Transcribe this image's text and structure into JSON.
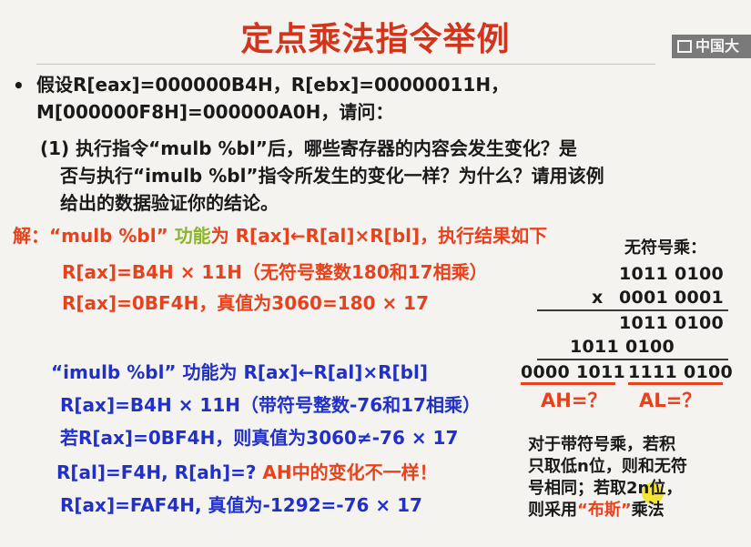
{
  "title": "定点乘法指令举例",
  "logo_text": "中国大",
  "problem": {
    "line1": "假设R[eax]=000000B4H，R[ebx]=00000011H，",
    "line2": "M[000000F8H]=000000A0H，请问：",
    "q1_line1": "(1) 执行指令“mulb %bl”后，哪些寄存器的内容会发生变化？是",
    "q1_line2": "否与执行“imulb %bl”指令所发生的变化一样？为什么？请用该例",
    "q1_line3": "给出的数据验证你的结论。"
  },
  "solution": {
    "prefix": "解：“mulb %bl”",
    "func_word": "功能",
    "rest": "为 R[ax]←R[al]×R[bl]，执行结果如下",
    "s1": "R[ax]=B4H × 11H（无符号整数180和17相乘）",
    "s2": "R[ax]=0BF4H，真值为3060=180 × 17"
  },
  "imul": {
    "title": "“imulb %bl” 功能为 R[ax]←R[al]×R[bl]",
    "i1": "R[ax]=B4H × 11H（带符号整数-76和17相乘）",
    "i2": "若R[ax]=0BF4H，则真值为3060≠-76 × 17",
    "i3_blue": "R[al]=F4H, R[ah]=? ",
    "i3_red": "AH中的变化不一样！",
    "i4": "R[ax]=FAF4H, 真值为-1292=-76 × 17"
  },
  "calc": {
    "header": "无符号乘：",
    "row1": "1011 0100",
    "times": "x",
    "row2": "0001 0001",
    "partial1": "1011 0100",
    "partial2": "1011 0100",
    "result_high": "0000 1011",
    "result_low": "1111 0100",
    "ah_label": "AH=？",
    "al_label": "AL=？"
  },
  "note": {
    "l1": "对于带符号乘，若积",
    "l2": "只取低n位，则和无符",
    "l3": "号相同；若取2n位，",
    "l4_a": "则采用",
    "l4_b": "“布斯”",
    "l4_c": "乘法"
  },
  "colors": {
    "title": "#d2341c",
    "red": "#e8421d",
    "blue": "#2030c8",
    "green": "#8fb42e"
  }
}
